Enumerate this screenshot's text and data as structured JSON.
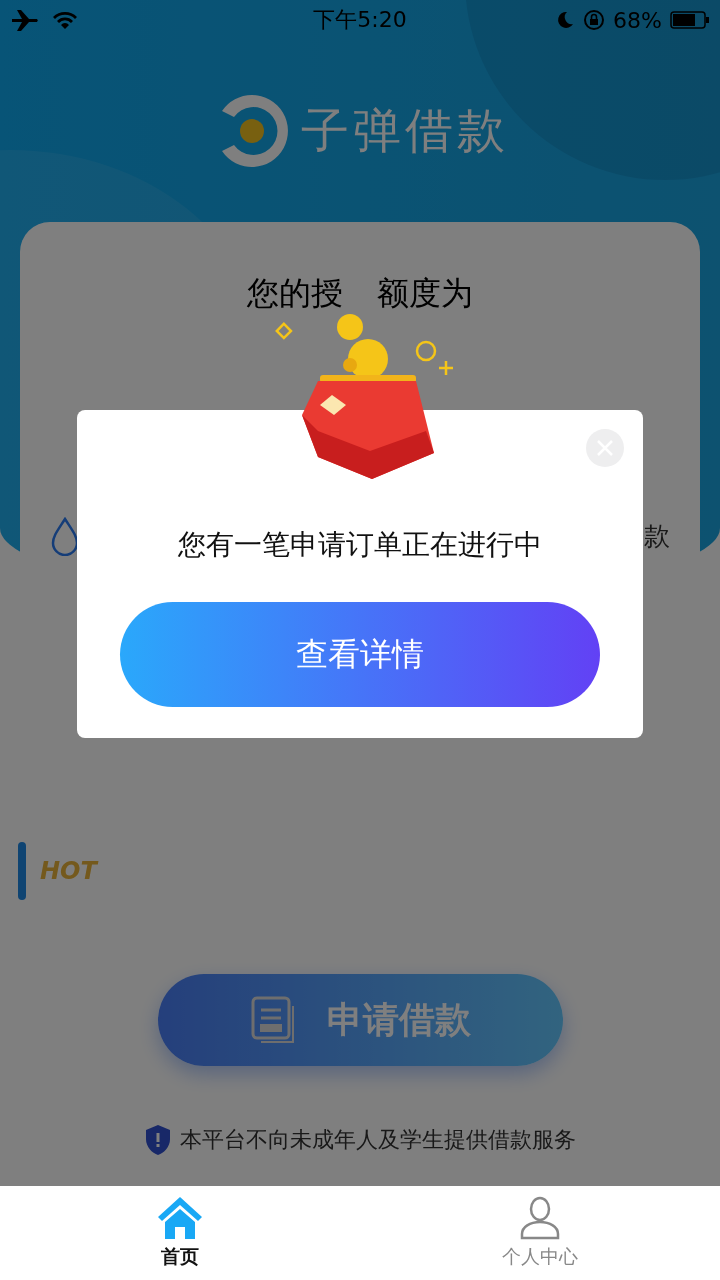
{
  "status_bar": {
    "time": "下午5:20",
    "battery": "68%"
  },
  "app": {
    "logo_text": "子弹借款"
  },
  "credit_card": {
    "title_parts": [
      "您的授",
      "额度为"
    ],
    "row_text_right": "款"
  },
  "hot_section": {
    "label": "HOT"
  },
  "apply_button": {
    "label": "申请借款"
  },
  "notice": "本平台不向未成年人及学生提供借款服务",
  "tabs": [
    {
      "label": "首页",
      "selected": true,
      "kind": "home"
    },
    {
      "label": "个人中心",
      "selected": false,
      "kind": "person"
    }
  ],
  "dialog": {
    "message": "您有一笔申请订单正在进行中",
    "button": "查看详情"
  }
}
